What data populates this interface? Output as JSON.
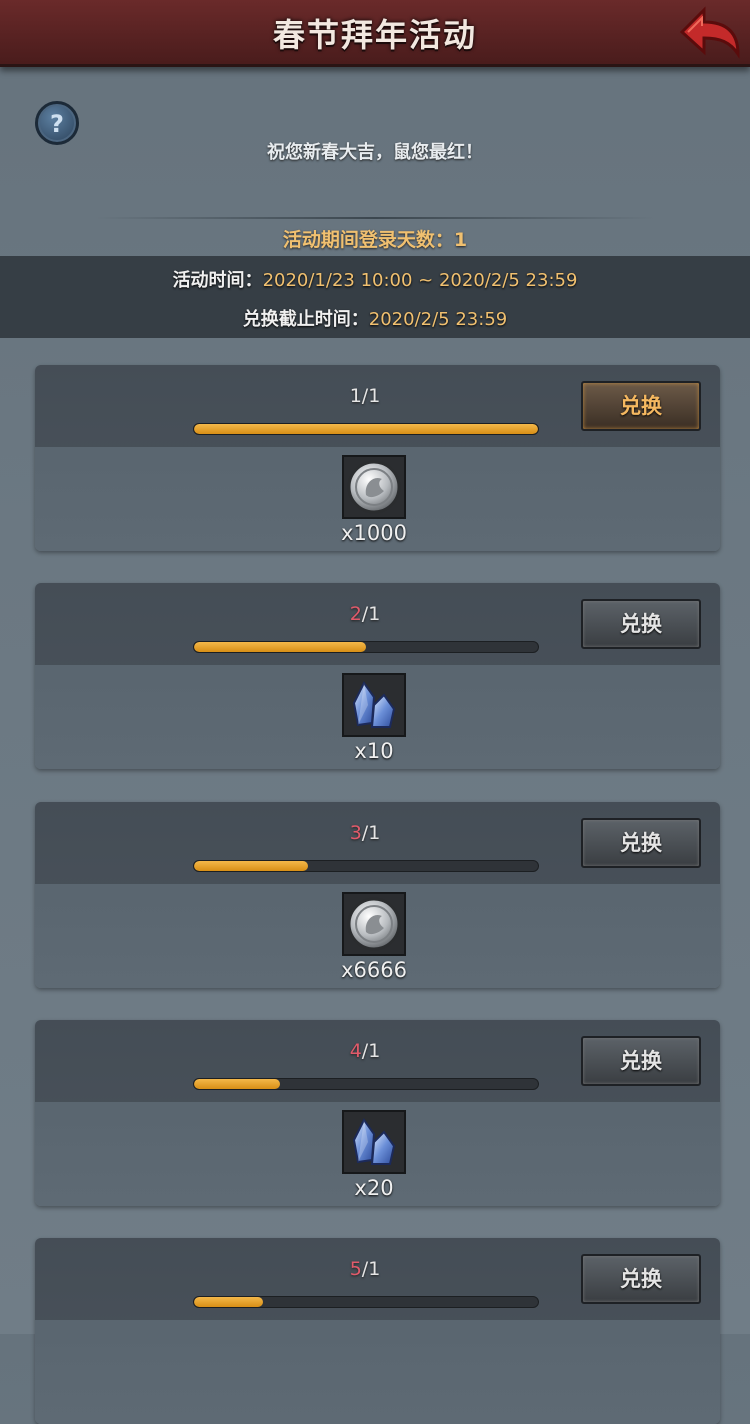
{
  "header": {
    "title": "春节拜年活动",
    "back_icon": "back-arrow-icon"
  },
  "help": {
    "label": "?"
  },
  "greeting": "祝您新春大吉，鼠您最红！",
  "login_days": "活动期间登录天数：1",
  "event": {
    "time_label": "活动时间：",
    "time_value": "2020/1/23 10:00 ~ 2020/2/5 23:59",
    "deadline_label": "兑换截止时间：",
    "deadline_value": "2020/2/5 23:59"
  },
  "colors": {
    "header_bg": "#5a2424",
    "accent_gold": "#f0c070",
    "progress_fill": "#e8a030",
    "red_count": "#e05a6a"
  },
  "rewards": [
    {
      "current": "1",
      "sep": "/",
      "required": "1",
      "progress": 1.0,
      "button": "兑换",
      "active": true,
      "icon": "silver-coin-icon",
      "qty": "x1000"
    },
    {
      "current": "2",
      "sep": "/",
      "required": "1",
      "progress": 0.5,
      "button": "兑换",
      "active": false,
      "icon": "blue-crystal-icon",
      "qty": "x10"
    },
    {
      "current": "3",
      "sep": "/",
      "required": "1",
      "progress": 0.33,
      "button": "兑换",
      "active": false,
      "icon": "silver-coin-icon",
      "qty": "x6666"
    },
    {
      "current": "4",
      "sep": "/",
      "required": "1",
      "progress": 0.25,
      "button": "兑换",
      "active": false,
      "icon": "blue-crystal-icon",
      "qty": "x20"
    },
    {
      "current": "5",
      "sep": "/",
      "required": "1",
      "progress": 0.2,
      "button": "兑换",
      "active": false,
      "icon": "",
      "qty": ""
    }
  ]
}
